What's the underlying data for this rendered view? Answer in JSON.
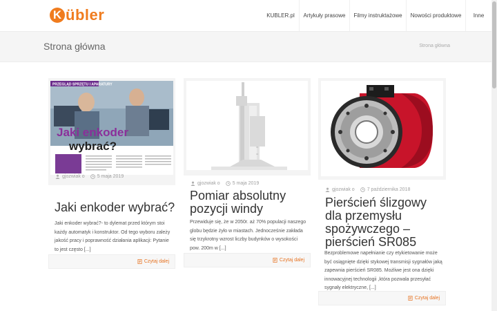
{
  "brand": {
    "logo_letter": "K",
    "logo_text": "übler"
  },
  "nav": [
    {
      "label": "KUBLER.pl"
    },
    {
      "label": "Artykuły prasowe"
    },
    {
      "label": "Filmy instruktażowe"
    },
    {
      "label": "Nowości produktowe"
    },
    {
      "label": "Inne"
    }
  ],
  "subheader": {
    "title": "Strona główna",
    "breadcrumb": "Strona główna"
  },
  "posts": [
    {
      "author": "gjozwiak o",
      "date": "5 maja 2019",
      "title": "Jaki enkoder wybrać?",
      "excerpt": "Jaki enkoder wybrać?- to dylemat przed którym stoi każdy automatyk i konstruktor. Od tego wyboru zależy jakość pracy i poprawność działania aplikacji: Pytanie to jest często [...]",
      "read_more": "Czytaj dalej",
      "image": {
        "banner": "PRZEGLĄD SPRZĘTU I APARATURY",
        "headline_line1": "Jaki enkoder",
        "headline_line2": "wybrać?"
      }
    },
    {
      "author": "gjozwiak o",
      "date": "5 maja 2019",
      "title": "Pomiar absolutny pozycji windy",
      "excerpt": "Przewiduje się, że w 2050r. aż 70% populacji naszego globu będzie żyło w miastach. Jednocześnie zakłada się trzykrotny wzrost liczby budynków o wysokości pow. 200m w [...]",
      "read_more": "Czytaj dalej"
    },
    {
      "author": "gjozwiak o",
      "date": "7 października 2018",
      "title": "Pierścień ślizgowy dla przemysłu spożywczego – pierścień SR085",
      "excerpt": "Bezproblemowe napełnianie czy etykietowanie może być osiągnięte dzięki stykowej transmisji sygnałów jaką zapewnia pierścień SR085. Możliwe jest ona dzięki innowacyjnej technologii ,która pozwala przesyłać sygnały elektryczne, [...]",
      "read_more": "Czytaj dalej"
    }
  ],
  "colors": {
    "accent": "#e6711f",
    "brand": "#f07c1e",
    "subheader_bg": "#f5f5f5"
  },
  "icons": {
    "author": "user-icon",
    "date": "clock-icon",
    "read_more": "document-icon"
  }
}
